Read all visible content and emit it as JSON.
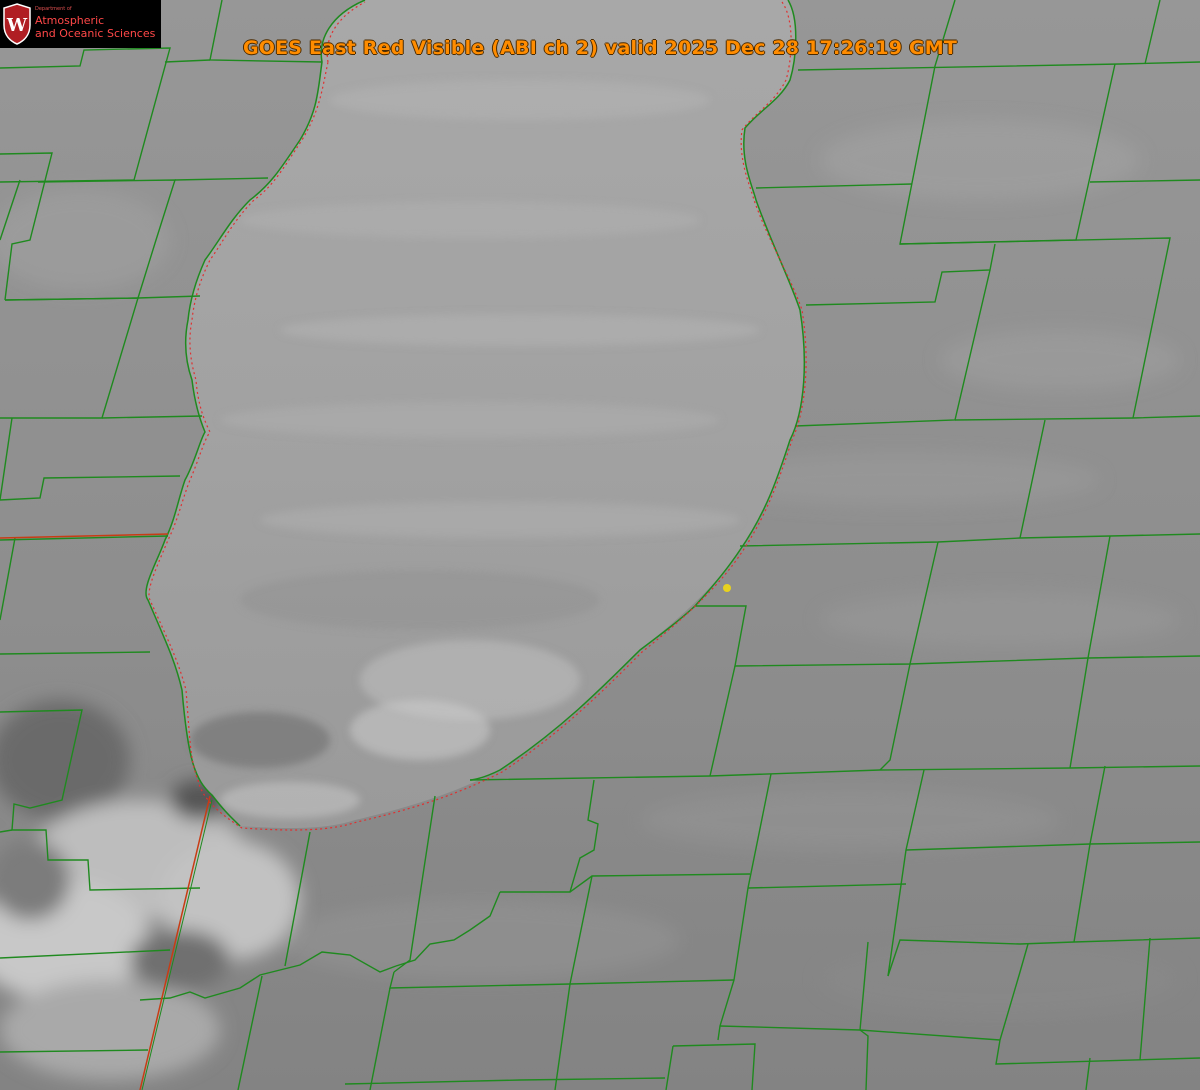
{
  "title": "GOES East Red Visible (ABI ch 2) valid 2025 Dec 28 17:26:19 GMT",
  "logo": {
    "crest_letter": "W",
    "department_line": "Department of",
    "name_line1": "Atmospheric",
    "name_line2": "and Oceanic Sciences"
  },
  "colors": {
    "title": "#ff8c00",
    "county_lines": "#1f8a1f",
    "state_line": "#c83c14",
    "lake_outline": "#e03030",
    "point_marker": "#e8d21e",
    "logo_bg": "#000000",
    "logo_text": "#ff4848",
    "crest_red": "#b01e23"
  },
  "map_layers": [
    "visible-satellite-imagery",
    "county-boundaries",
    "state-boundaries",
    "lake-outline",
    "point-marker"
  ],
  "icons": [
    "uw-crest-icon",
    "point-marker-icon"
  ]
}
